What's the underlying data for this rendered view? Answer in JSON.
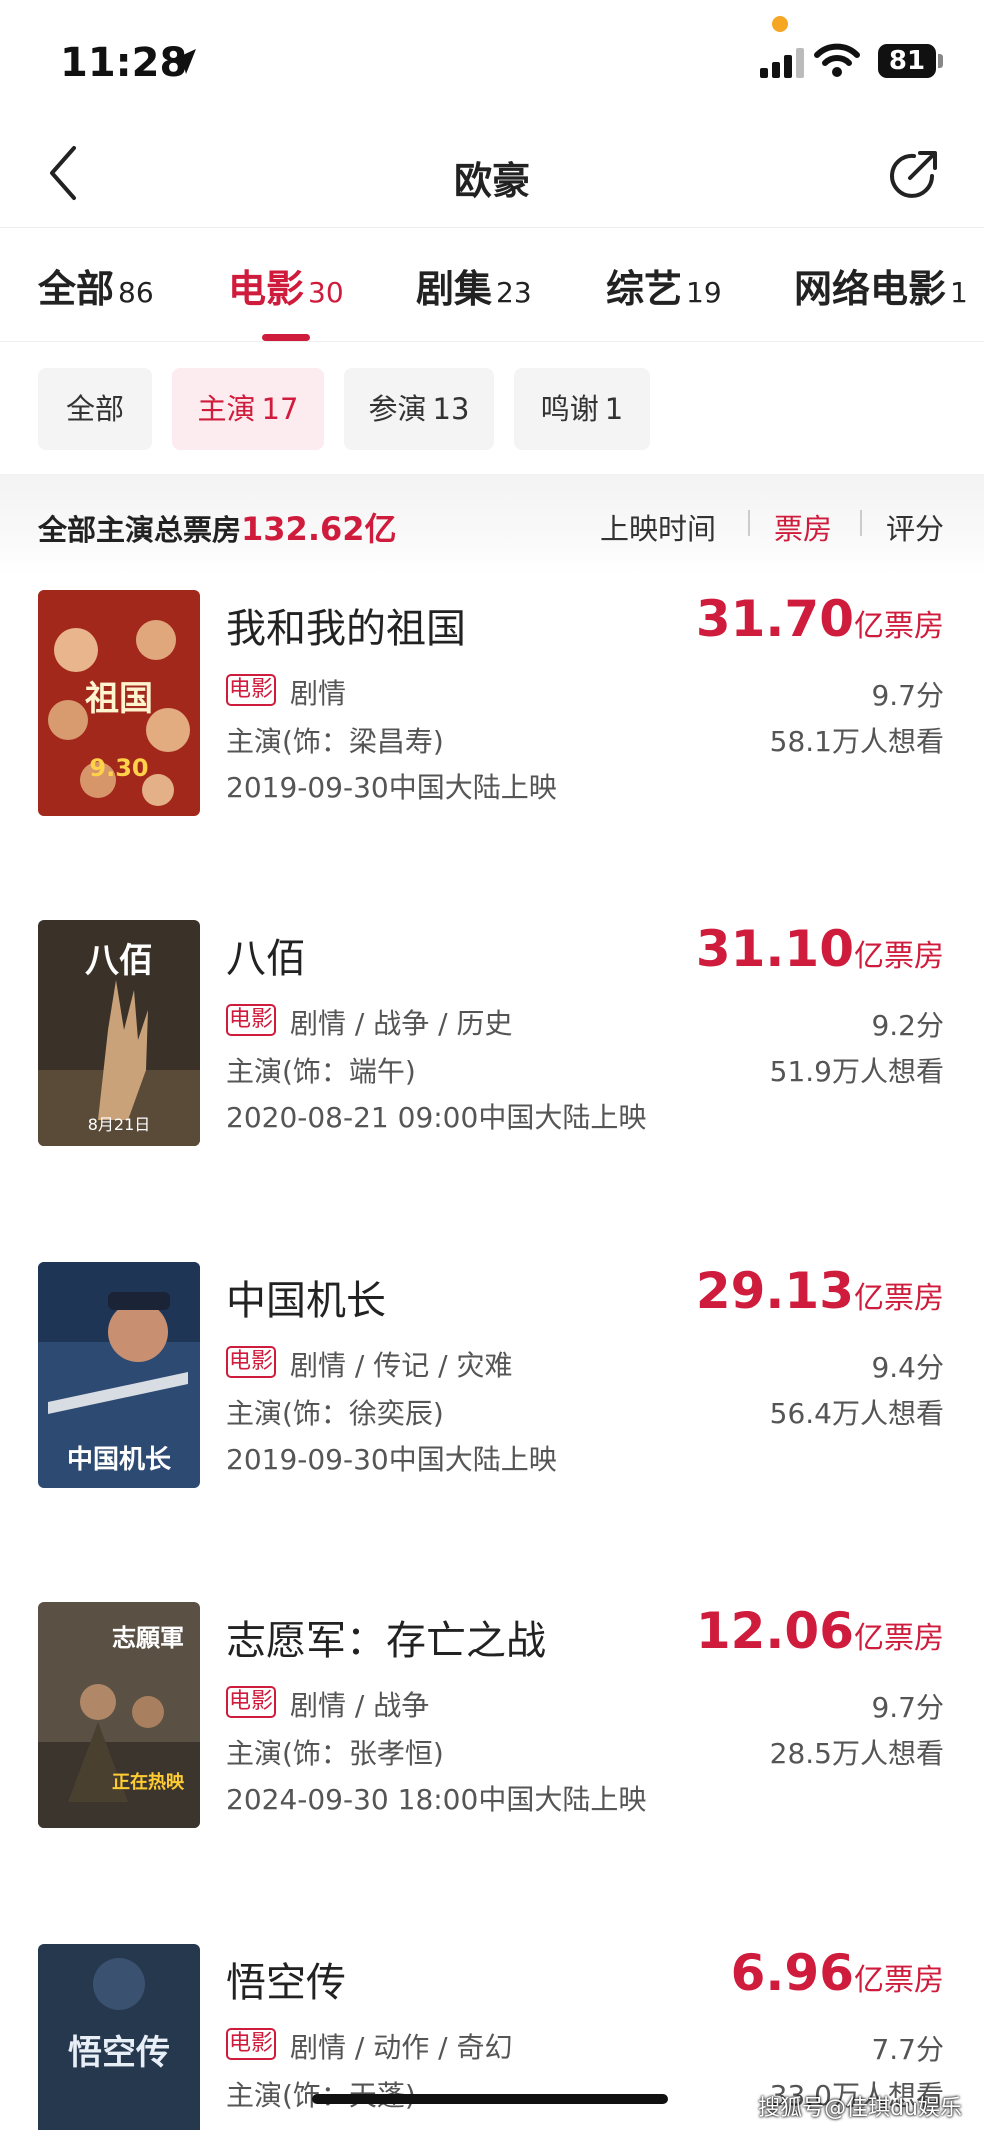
{
  "status_bar": {
    "time": "11:28",
    "battery": "81"
  },
  "nav": {
    "title": "欧豪"
  },
  "tabs": [
    {
      "label": "全部",
      "count": "86"
    },
    {
      "label": "电影",
      "count": "30"
    },
    {
      "label": "剧集",
      "count": "23"
    },
    {
      "label": "综艺",
      "count": "19"
    },
    {
      "label": "网络电影",
      "count": "1"
    }
  ],
  "chips": [
    {
      "label": "全部",
      "count": ""
    },
    {
      "label": "主演",
      "count": "17"
    },
    {
      "label": "参演",
      "count": "13"
    },
    {
      "label": "鸣谢",
      "count": "1"
    }
  ],
  "summary": {
    "label": "全部主演总票房",
    "value": "132.62亿",
    "sort_options": [
      "上映时间",
      "票房",
      "评分"
    ]
  },
  "movies": [
    {
      "title": "我和我的祖国",
      "tag": "电影",
      "genres": "剧情",
      "role": "主演(饰：梁昌寿)",
      "release": "2019-09-30中国大陆上映",
      "box_office": "31.70",
      "box_unit": "亿票房",
      "score": "9.7分",
      "want": "58.1万人想看",
      "poster_text": "我和我的祖国",
      "poster_color": "#a3281c"
    },
    {
      "title": "八佰",
      "tag": "电影",
      "genres": "剧情 / 战争 / 历史",
      "role": "主演(饰：端午)",
      "release": "2020-08-21 09:00中国大陆上映",
      "box_office": "31.10",
      "box_unit": "亿票房",
      "score": "9.2分",
      "want": "51.9万人想看",
      "poster_text": "八佰",
      "poster_color": "#3a3228"
    },
    {
      "title": "中国机长",
      "tag": "电影",
      "genres": "剧情 / 传记 / 灾难",
      "role": "主演(饰：徐奕辰)",
      "release": "2019-09-30中国大陆上映",
      "box_office": "29.13",
      "box_unit": "亿票房",
      "score": "9.4分",
      "want": "56.4万人想看",
      "poster_text": "中国机长",
      "poster_color": "#2d4a72"
    },
    {
      "title": "志愿军：存亡之战",
      "tag": "电影",
      "genres": "剧情 / 战争",
      "role": "主演(饰：张孝恒)",
      "release": "2024-09-30 18:00中国大陆上映",
      "box_office": "12.06",
      "box_unit": "亿票房",
      "score": "9.7分",
      "want": "28.5万人想看",
      "poster_text": "志願軍",
      "poster_color": "#5a5044"
    },
    {
      "title": "悟空传",
      "tag": "电影",
      "genres": "剧情 / 动作 / 奇幻",
      "role": "主演(饰：天蓬)",
      "release": "",
      "box_office": "6.96",
      "box_unit": "亿票房",
      "score": "7.7分",
      "want": "33.0万人想看",
      "poster_text": "悟空传",
      "poster_color": "#26384e"
    }
  ],
  "watermark": "搜狐号@佳琪du娱乐",
  "colors": {
    "accent": "#d01c3c",
    "chip_active_bg": "#fdecef",
    "status_dot": "#f5a623"
  }
}
